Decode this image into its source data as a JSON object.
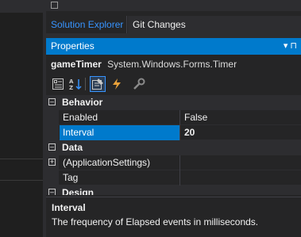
{
  "tabs": [
    {
      "label": "Solution Explorer",
      "active": true
    },
    {
      "label": "Git Changes",
      "active": false
    }
  ],
  "properties_panel": {
    "title": "Properties",
    "pin_glyph": "▾ ⊓"
  },
  "selected_object": {
    "name": "gameTimer",
    "type": "System.Windows.Forms.Timer"
  },
  "toolbar": {
    "buttons": [
      "categorized-icon",
      "alphabetical-icon",
      "properties-icon",
      "events-icon",
      "property-pages-icon"
    ],
    "selected": "properties-icon"
  },
  "grid": {
    "categories": [
      {
        "label": "Behavior",
        "expanded": true,
        "toggle": "–",
        "properties": [
          {
            "name": "Enabled",
            "value": "False"
          },
          {
            "name": "Interval",
            "value": "20",
            "selected": true
          }
        ]
      },
      {
        "label": "Data",
        "expanded": true,
        "toggle": "–",
        "properties": [
          {
            "name": "(ApplicationSettings)",
            "value": "",
            "expandable": true,
            "toggle": "+"
          },
          {
            "name": "Tag",
            "value": ""
          }
        ]
      },
      {
        "label": "Design",
        "expanded": true,
        "toggle": "–"
      }
    ]
  },
  "description": {
    "title": "Interval",
    "text": "The frequency of Elapsed events in milliseconds."
  },
  "colors": {
    "accent": "#007acc",
    "tab_active_text": "#3794ff",
    "background": "#252526",
    "chrome": "#2d2d30"
  }
}
